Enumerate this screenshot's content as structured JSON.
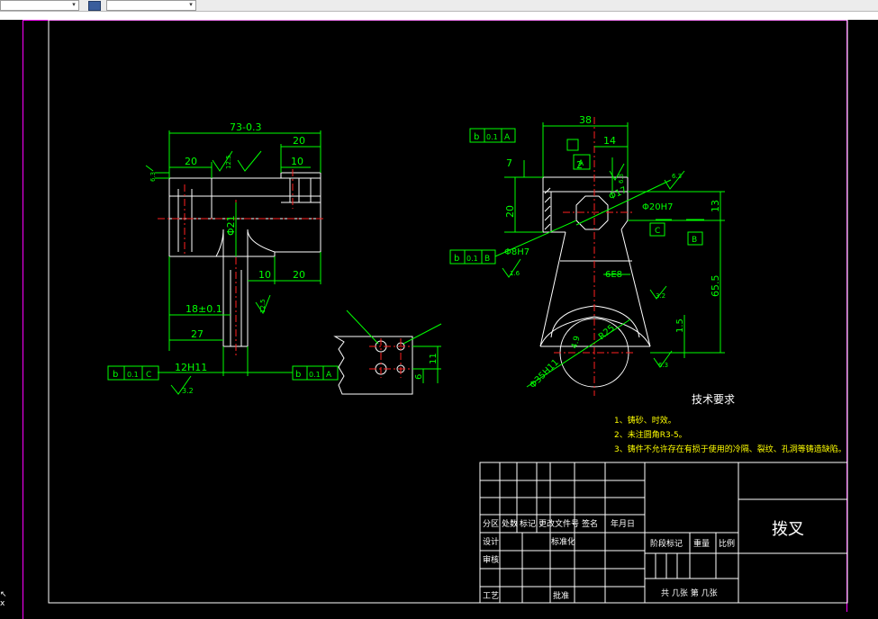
{
  "left_view": {
    "dim_overall": "73-0.3",
    "dim_20_top_left": "20",
    "dim_20_top_right": "20",
    "dim_10_top": "10",
    "dim_dia21": "Φ21",
    "dim_10_bottom": "10",
    "dim_20_bottom": "20",
    "dim_18": "18±0.1",
    "dim_27": "27",
    "dim_12h11": "12H11",
    "rough_3_2": "3.2",
    "rough_6_3": "6.3",
    "rough_12_5_a": "12.5",
    "rough_12_5_b": "12.5",
    "tol_frame_left": [
      "b",
      "0.1",
      "C"
    ],
    "tol_frame_right": [
      "b",
      "0.1",
      "A"
    ]
  },
  "detail_view": {
    "dim_11": "11",
    "dim_6": "6"
  },
  "right_view": {
    "dim_38": "38",
    "dim_14": "14",
    "dim_7": "7",
    "dim_2": "2",
    "dim_20": "20",
    "dim_13": "13",
    "dim_65_5": "65.5",
    "dim_1_5": "1.5",
    "dim_dia17": "Φ17",
    "dim_dia20h7": "Φ20H7",
    "dim_dia8h7": "Φ8H7",
    "dim_6e8": "6E8",
    "dim_r25": "R25",
    "dim_4_9": "4.9",
    "dim_dia35h11": "Φ35H11",
    "rough_6_3_a": "6.3",
    "rough_6_3_b": "6.3",
    "rough_3_2": "3.2",
    "rough_1_6": "1.6",
    "rough_6_3_c": "6.3",
    "tol_frame_top": [
      "b",
      "0.1",
      "A"
    ],
    "tol_frame_mid": [
      "b",
      "0.1",
      "B"
    ],
    "datum_a": "A",
    "datum_b": "B",
    "datum_c": "C"
  },
  "tech_requirements": {
    "title": "技术要求",
    "items": [
      "1、铸砂、时效。",
      "2、未注圆角R3-5。",
      "3、铸件不允许存在有损于使用的冷隔、裂纹、孔洞等铸造缺陷。"
    ]
  },
  "title_block": {
    "part_name": "拨叉",
    "header_row": [
      "分区",
      "处数",
      "标记",
      "更改文件号",
      "签名",
      "年月日"
    ],
    "design": "设计",
    "standardize": "标准化",
    "review": "审核",
    "approve": "批准",
    "craft": "工艺",
    "stage_mark": "阶段标记",
    "weight": "重量",
    "scale": "比例",
    "sheets": "共  几张  第  几张"
  }
}
